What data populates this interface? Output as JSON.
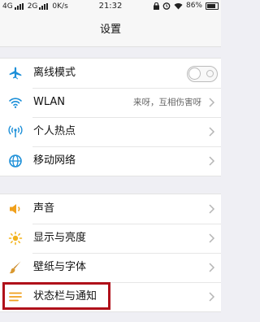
{
  "status_bar": {
    "sim1": "4G",
    "sim2": "2G",
    "speed": "0K/s",
    "time": "21:32",
    "battery": "86%"
  },
  "header": {
    "title": "设置"
  },
  "groups": [
    {
      "items": [
        {
          "label": "离线模式",
          "icon": "airplane-icon",
          "control": "toggle",
          "toggle_on": false
        },
        {
          "label": "WLAN",
          "icon": "wifi-icon",
          "value": "来呀，互相伤害呀"
        },
        {
          "label": "个人热点",
          "icon": "hotspot-icon"
        },
        {
          "label": "移动网络",
          "icon": "globe-icon"
        }
      ]
    },
    {
      "items": [
        {
          "label": "声音",
          "icon": "speaker-icon"
        },
        {
          "label": "显示与亮度",
          "icon": "brightness-icon"
        },
        {
          "label": "壁纸与字体",
          "icon": "brush-icon"
        },
        {
          "label": "状态栏与通知",
          "icon": "notification-bar-icon",
          "highlighted": true
        }
      ]
    }
  ],
  "colors": {
    "accent": "#1c8fd8",
    "sound_icon": "#f0a01c",
    "brightness_icon": "#f2b21b",
    "highlight_border": "#b0101a"
  }
}
